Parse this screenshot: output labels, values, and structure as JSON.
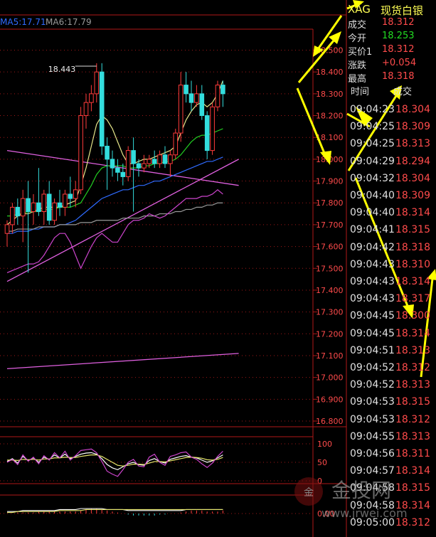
{
  "instrument": {
    "symbol": "XAG",
    "name": "现货白银"
  },
  "quote": [
    {
      "label": "成交",
      "value": "18.312",
      "color": "#ff4b4b"
    },
    {
      "label": "今开",
      "value": "18.253",
      "color": "#22dd22"
    },
    {
      "label": "买价1",
      "value": "18.312",
      "color": "#ff4b4b"
    },
    {
      "label": "涨跌",
      "value": "+0.054",
      "color": "#ff4b4b"
    },
    {
      "label": "最高",
      "value": "18.318",
      "color": "#ff4b4b"
    }
  ],
  "ticks_header": {
    "time": "时间",
    "trade": "成交"
  },
  "ticks": [
    {
      "time": "09:04:23",
      "price": "18.304"
    },
    {
      "time": "09:04:25",
      "price": "18.309"
    },
    {
      "time": "09:04:25",
      "price": "18.313"
    },
    {
      "time": "09:04:29",
      "price": "18.294"
    },
    {
      "time": "09:04:32",
      "price": "18.304"
    },
    {
      "time": "09:04:40",
      "price": "18.309"
    },
    {
      "time": "09:04:40",
      "price": "18.314"
    },
    {
      "time": "09:04:41",
      "price": "18.315"
    },
    {
      "time": "09:04:42",
      "price": "18.318"
    },
    {
      "time": "09:04:43",
      "price": "18.310"
    },
    {
      "time": "09:04:43",
      "price": "18.314"
    },
    {
      "time": "09:04:43",
      "price": "18.317"
    },
    {
      "time": "09:04:45",
      "price": "18.300"
    },
    {
      "time": "09:04:45",
      "price": "18.314"
    },
    {
      "time": "09:04:51",
      "price": "18.313"
    },
    {
      "time": "09:04:52",
      "price": "18.312"
    },
    {
      "time": "09:04:52",
      "price": "18.313"
    },
    {
      "time": "09:04:53",
      "price": "18.315"
    },
    {
      "time": "09:04:53",
      "price": "18.312"
    },
    {
      "time": "09:04:55",
      "price": "18.313"
    },
    {
      "time": "09:04:56",
      "price": "18.311"
    },
    {
      "time": "09:04:57",
      "price": "18.314"
    },
    {
      "time": "09:04:58",
      "price": "18.315"
    },
    {
      "time": "09:04:58",
      "price": "18.314"
    },
    {
      "time": "09:05:00",
      "price": "18.312"
    }
  ],
  "ma_legend": [
    {
      "text": "MA5:17.71",
      "color": "#2f6bff"
    },
    {
      "text": "MA6:17.79",
      "color": "#999999"
    }
  ],
  "watermark": {
    "brand": "金投网",
    "url": "www.jrwei.com"
  },
  "chart_data": [
    {
      "type": "candlestick",
      "title": "",
      "ylim": [
        16.8,
        18.6
      ],
      "yticks": [
        "18.500",
        "18.400",
        "18.300",
        "18.200",
        "18.100",
        "18.000",
        "17.900",
        "17.800",
        "17.700",
        "17.600",
        "17.500",
        "17.400",
        "17.300",
        "17.200",
        "17.100",
        "17.000",
        "16.900",
        "16.800"
      ],
      "annotations": [
        {
          "text": "18.443",
          "candle_index": 17,
          "value": 18.443
        }
      ],
      "bars": [
        {
          "o": 17.66,
          "h": 17.72,
          "l": 17.6,
          "c": 17.7
        },
        {
          "o": 17.7,
          "h": 17.8,
          "l": 17.66,
          "c": 17.78
        },
        {
          "o": 17.78,
          "h": 17.82,
          "l": 17.7,
          "c": 17.74
        },
        {
          "o": 17.74,
          "h": 17.86,
          "l": 17.62,
          "c": 17.82
        },
        {
          "o": 17.82,
          "h": 17.9,
          "l": 17.48,
          "c": 17.76
        },
        {
          "o": 17.76,
          "h": 17.84,
          "l": 17.7,
          "c": 17.8
        },
        {
          "o": 17.8,
          "h": 17.96,
          "l": 17.74,
          "c": 17.76
        },
        {
          "o": 17.76,
          "h": 17.86,
          "l": 17.7,
          "c": 17.84
        },
        {
          "o": 17.84,
          "h": 17.9,
          "l": 17.7,
          "c": 17.72
        },
        {
          "o": 17.72,
          "h": 17.82,
          "l": 17.7,
          "c": 17.8
        },
        {
          "o": 17.8,
          "h": 17.86,
          "l": 17.74,
          "c": 17.78
        },
        {
          "o": 17.78,
          "h": 17.86,
          "l": 17.74,
          "c": 17.84
        },
        {
          "o": 17.84,
          "h": 17.92,
          "l": 17.78,
          "c": 17.82
        },
        {
          "o": 17.82,
          "h": 17.9,
          "l": 17.78,
          "c": 17.86
        },
        {
          "o": 17.86,
          "h": 18.24,
          "l": 17.84,
          "c": 18.2
        },
        {
          "o": 18.2,
          "h": 18.3,
          "l": 18.14,
          "c": 18.26
        },
        {
          "o": 18.26,
          "h": 18.34,
          "l": 18.22,
          "c": 18.3
        },
        {
          "o": 18.3,
          "h": 18.44,
          "l": 18.26,
          "c": 18.4
        },
        {
          "o": 18.4,
          "h": 18.44,
          "l": 18.02,
          "c": 18.06
        },
        {
          "o": 18.06,
          "h": 18.1,
          "l": 17.86,
          "c": 18.0
        },
        {
          "o": 18.0,
          "h": 18.04,
          "l": 17.92,
          "c": 17.96
        },
        {
          "o": 17.96,
          "h": 18.0,
          "l": 17.9,
          "c": 17.94
        },
        {
          "o": 17.94,
          "h": 17.98,
          "l": 17.88,
          "c": 17.92
        },
        {
          "o": 17.92,
          "h": 18.06,
          "l": 17.9,
          "c": 18.04
        },
        {
          "o": 18.04,
          "h": 18.1,
          "l": 17.76,
          "c": 17.98
        },
        {
          "o": 17.98,
          "h": 18.0,
          "l": 17.92,
          "c": 17.96
        },
        {
          "o": 17.96,
          "h": 18.02,
          "l": 17.94,
          "c": 17.98
        },
        {
          "o": 17.98,
          "h": 18.02,
          "l": 17.96,
          "c": 18.0
        },
        {
          "o": 18.0,
          "h": 18.04,
          "l": 17.96,
          "c": 17.98
        },
        {
          "o": 17.98,
          "h": 18.04,
          "l": 17.96,
          "c": 18.02
        },
        {
          "o": 18.02,
          "h": 18.06,
          "l": 17.96,
          "c": 17.98
        },
        {
          "o": 17.98,
          "h": 18.04,
          "l": 17.92,
          "c": 18.02
        },
        {
          "o": 18.02,
          "h": 18.14,
          "l": 18.0,
          "c": 18.12
        },
        {
          "o": 18.12,
          "h": 18.4,
          "l": 18.08,
          "c": 18.34
        },
        {
          "o": 18.34,
          "h": 18.4,
          "l": 18.26,
          "c": 18.3
        },
        {
          "o": 18.3,
          "h": 18.36,
          "l": 18.22,
          "c": 18.26
        },
        {
          "o": 18.26,
          "h": 18.34,
          "l": 18.24,
          "c": 18.3
        },
        {
          "o": 18.3,
          "h": 18.34,
          "l": 18.18,
          "c": 18.2
        },
        {
          "o": 18.2,
          "h": 18.22,
          "l": 18.0,
          "c": 18.04
        },
        {
          "o": 18.04,
          "h": 18.26,
          "l": 18.02,
          "c": 18.24
        },
        {
          "o": 18.24,
          "h": 18.36,
          "l": 18.22,
          "c": 18.34
        },
        {
          "o": 18.34,
          "h": 18.36,
          "l": 18.24,
          "c": 18.3
        }
      ],
      "lines": [
        {
          "color": "#e6e68a",
          "values": [
            17.7,
            17.72,
            17.74,
            17.75,
            17.75,
            17.76,
            17.77,
            17.78,
            17.78,
            17.78,
            17.78,
            17.79,
            17.8,
            17.81,
            17.88,
            17.96,
            18.06,
            18.16,
            18.2,
            18.18,
            18.14,
            18.08,
            18.02,
            17.98,
            17.98,
            17.99,
            18.0,
            18.0,
            18.01,
            18.02,
            18.03,
            18.04,
            18.06,
            18.12,
            18.18,
            18.22,
            18.25,
            18.26,
            18.24,
            18.26,
            18.3,
            18.36
          ]
        },
        {
          "color": "#22cc22",
          "values": [
            17.74,
            17.74,
            17.75,
            17.75,
            17.76,
            17.76,
            17.76,
            17.77,
            17.77,
            17.77,
            17.78,
            17.78,
            17.78,
            17.79,
            17.8,
            17.84,
            17.88,
            17.93,
            17.96,
            17.97,
            17.97,
            17.97,
            17.97,
            17.96,
            17.96,
            17.96,
            17.97,
            17.97,
            17.98,
            17.98,
            17.99,
            17.99,
            18.0,
            18.02,
            18.05,
            18.08,
            18.1,
            18.11,
            18.11,
            18.12,
            18.13,
            18.14
          ]
        },
        {
          "color": "#2f6bff",
          "values": [
            17.66,
            17.66,
            17.67,
            17.67,
            17.67,
            17.68,
            17.68,
            17.69,
            17.69,
            17.69,
            17.7,
            17.7,
            17.71,
            17.72,
            17.74,
            17.76,
            17.78,
            17.8,
            17.82,
            17.83,
            17.84,
            17.85,
            17.86,
            17.86,
            17.87,
            17.88,
            17.88,
            17.89,
            17.9,
            17.9,
            17.91,
            17.92,
            17.93,
            17.94,
            17.95,
            17.96,
            17.97,
            17.98,
            17.99,
            17.99,
            18.0,
            18.01
          ]
        },
        {
          "color": "#999999",
          "values": [
            17.67,
            17.67,
            17.68,
            17.68,
            17.68,
            17.68,
            17.69,
            17.69,
            17.69,
            17.69,
            17.7,
            17.7,
            17.7,
            17.7,
            17.71,
            17.71,
            17.71,
            17.72,
            17.72,
            17.72,
            17.72,
            17.72,
            17.73,
            17.73,
            17.73,
            17.73,
            17.74,
            17.74,
            17.74,
            17.75,
            17.75,
            17.75,
            17.76,
            17.76,
            17.77,
            17.77,
            17.78,
            17.78,
            17.79,
            17.79,
            17.8,
            17.8
          ]
        },
        {
          "color": "#cc44cc",
          "values": [
            17.48,
            17.49,
            17.5,
            17.51,
            17.52,
            17.52,
            17.53,
            17.56,
            17.6,
            17.64,
            17.66,
            17.66,
            17.62,
            17.56,
            17.5,
            17.55,
            17.6,
            17.64,
            17.66,
            17.64,
            17.62,
            17.62,
            17.66,
            17.7,
            17.72,
            17.72,
            17.73,
            17.75,
            17.74,
            17.73,
            17.74,
            17.76,
            17.78,
            17.8,
            17.82,
            17.82,
            17.82,
            17.83,
            17.83,
            17.84,
            17.86,
            17.84
          ]
        }
      ],
      "trendlines": [
        {
          "color": "#e060e0",
          "from": [
            0,
            17.44
          ],
          "to": [
            44,
            18.0
          ]
        },
        {
          "color": "#e060e0",
          "from": [
            0,
            18.04
          ],
          "to": [
            44,
            17.88
          ]
        },
        {
          "color": "#e060e0",
          "from": [
            0,
            17.04
          ],
          "to": [
            44,
            17.11
          ]
        }
      ]
    },
    {
      "type": "line",
      "title": "",
      "ylim": [
        0,
        100
      ],
      "yticks": [
        "100",
        "50",
        "0"
      ],
      "series": [
        {
          "color": "#ffffff",
          "values": [
            52,
            60,
            48,
            66,
            55,
            62,
            50,
            64,
            58,
            70,
            62,
            72,
            60,
            66,
            72,
            75,
            76,
            72,
            60,
            44,
            35,
            30,
            38,
            46,
            50,
            44,
            42,
            55,
            60,
            52,
            48,
            58,
            62,
            66,
            68,
            64,
            62,
            56,
            50,
            54,
            62,
            70
          ]
        },
        {
          "color": "#e6e66a",
          "values": [
            56,
            56,
            55,
            58,
            57,
            58,
            56,
            59,
            59,
            62,
            62,
            64,
            63,
            63,
            66,
            68,
            70,
            70,
            66,
            58,
            50,
            42,
            40,
            42,
            45,
            45,
            44,
            48,
            52,
            52,
            51,
            54,
            57,
            60,
            63,
            64,
            63,
            61,
            57,
            56,
            58,
            63
          ]
        },
        {
          "color": "#cc44cc",
          "values": [
            50,
            58,
            44,
            70,
            53,
            64,
            46,
            68,
            56,
            76,
            62,
            80,
            56,
            68,
            82,
            84,
            86,
            76,
            52,
            26,
            18,
            12,
            30,
            50,
            58,
            40,
            38,
            64,
            72,
            50,
            42,
            66,
            70,
            76,
            78,
            64,
            58,
            46,
            36,
            48,
            66,
            80
          ]
        }
      ]
    },
    {
      "type": "bar",
      "title": "",
      "ylim": [
        -0.1,
        0.1
      ],
      "yticks": [
        "0.00"
      ],
      "values": [
        0.0,
        0.0,
        0.01,
        0.01,
        0.01,
        0.01,
        0.02,
        0.02,
        0.02,
        0.02,
        0.02,
        0.02,
        0.02,
        0.02,
        0.03,
        0.04,
        0.05,
        0.05,
        0.04,
        0.03,
        0.02,
        0.01,
        0.0,
        -0.01,
        -0.02,
        -0.02,
        -0.02,
        -0.02,
        -0.02,
        -0.01,
        -0.01,
        0.0,
        0.0,
        0.01,
        0.02,
        0.03,
        0.03,
        0.03,
        0.02,
        0.02,
        0.02,
        0.03
      ],
      "lines": [
        {
          "color": "#ffffff",
          "values": [
            0.02,
            0.02,
            0.02,
            0.03,
            0.03,
            0.03,
            0.03,
            0.03,
            0.03,
            0.03,
            0.04,
            0.04,
            0.04,
            0.04,
            0.05,
            0.05,
            0.05,
            0.05,
            0.05,
            0.04,
            0.04,
            0.04,
            0.04,
            0.03,
            0.03,
            0.03,
            0.03,
            0.03,
            0.03,
            0.03,
            0.03,
            0.03,
            0.03,
            0.03,
            0.04,
            0.04,
            0.04,
            0.04,
            0.04,
            0.04,
            0.04,
            0.04
          ]
        },
        {
          "color": "#e6e66a",
          "values": [
            0.01,
            0.01,
            0.02,
            0.02,
            0.02,
            0.02,
            0.02,
            0.02,
            0.02,
            0.02,
            0.03,
            0.03,
            0.03,
            0.03,
            0.03,
            0.04,
            0.04,
            0.04,
            0.04,
            0.04,
            0.04,
            0.04,
            0.04,
            0.04,
            0.04,
            0.04,
            0.04,
            0.04,
            0.04,
            0.04,
            0.04,
            0.04,
            0.04,
            0.04,
            0.04,
            0.04,
            0.04,
            0.04,
            0.04,
            0.04,
            0.04,
            0.04
          ]
        }
      ]
    }
  ]
}
